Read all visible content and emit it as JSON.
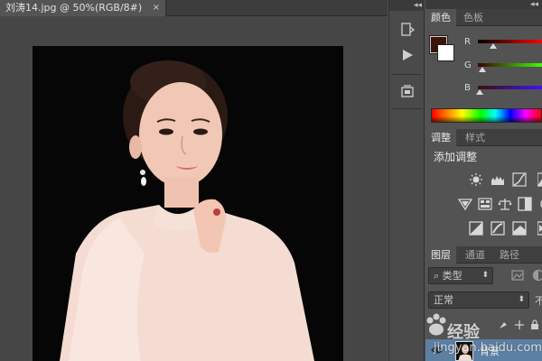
{
  "document": {
    "tab_title": "刘涛14.jpg @ 50%(RGB/8#)",
    "close_glyph": "×"
  },
  "collapse_glyph": "◂◂",
  "color_panel": {
    "tabs": [
      "颜色",
      "色板"
    ],
    "foreground_color": "#3d1209",
    "background_color": "#ffffff",
    "channels": [
      {
        "label": "R",
        "value_fraction": 0.24,
        "gradient": "linear-gradient(to right,#000,#ff0000)"
      },
      {
        "label": "G",
        "value_fraction": 0.07,
        "gradient": "linear-gradient(to right,#3d0000,#3dff00)"
      },
      {
        "label": "B",
        "value_fraction": 0.03,
        "gradient": "linear-gradient(to right,#3d1200,#3d12ff)"
      }
    ]
  },
  "adjustments_panel": {
    "tabs": [
      "调整",
      "样式"
    ],
    "title": "添加调整",
    "icons": [
      "brightness-contrast-icon",
      "levels-icon",
      "curves-icon",
      "exposure-icon",
      "vibrance-icon",
      "hue-saturation-icon",
      "color-balance-icon",
      "black-white-icon",
      "photo-filter-icon",
      "invert-icon",
      "posterize-icon",
      "threshold-icon",
      "selective-color-icon"
    ]
  },
  "layers_panel": {
    "tabs": [
      "图层",
      "通道",
      "路径"
    ],
    "filter_label": "类型",
    "blend_mode": "正常",
    "opacity_label_partial": "不",
    "layer_name": "背景"
  },
  "watermark": {
    "brand": "经验",
    "url": "jingyan.baidu.com"
  }
}
